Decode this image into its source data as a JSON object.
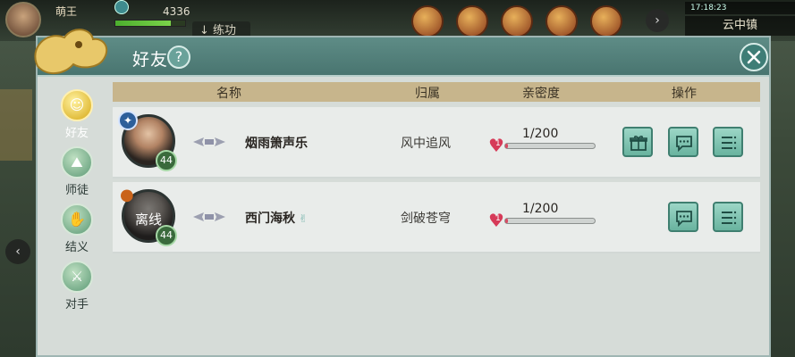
{
  "hud": {
    "player_name": "萌王",
    "power": "4336",
    "hp_fraction": 0.8,
    "train_label": "练功",
    "time_status": "17:18:23",
    "location": "云中镇"
  },
  "panel": {
    "title": "好友",
    "help": "?",
    "nav": [
      {
        "label": "好友",
        "active": true
      },
      {
        "label": "师徒",
        "active": false
      },
      {
        "label": "结义",
        "active": false
      },
      {
        "label": "对手",
        "active": false
      }
    ],
    "columns": {
      "name": "名称",
      "guild": "归属",
      "intimacy": "亲密度",
      "actions": "操作"
    },
    "friends": [
      {
        "name": "烟雨箫声乐",
        "guild": "风中追风",
        "intimacy": "1/200",
        "intimacy_fraction": 0.005,
        "heart_level": "1",
        "level": "44",
        "status_text": "",
        "badge_icon": "star-badge-icon",
        "has_gift": true,
        "offline": false
      },
      {
        "name": "西门海秋",
        "guild": "剑破苍穹",
        "intimacy": "1/200",
        "intimacy_fraction": 0.005,
        "heart_level": "1",
        "level": "44",
        "status_text": "离线",
        "badge_icon": "gourd-badge-icon",
        "has_gift": false,
        "offline": true
      }
    ]
  },
  "colors": {
    "header_teal": "#5e8c86",
    "column_header": "#c7b58c",
    "row_bg": "#e9ecea",
    "heart": "#d63a58",
    "button_mint": "#69b39f"
  }
}
